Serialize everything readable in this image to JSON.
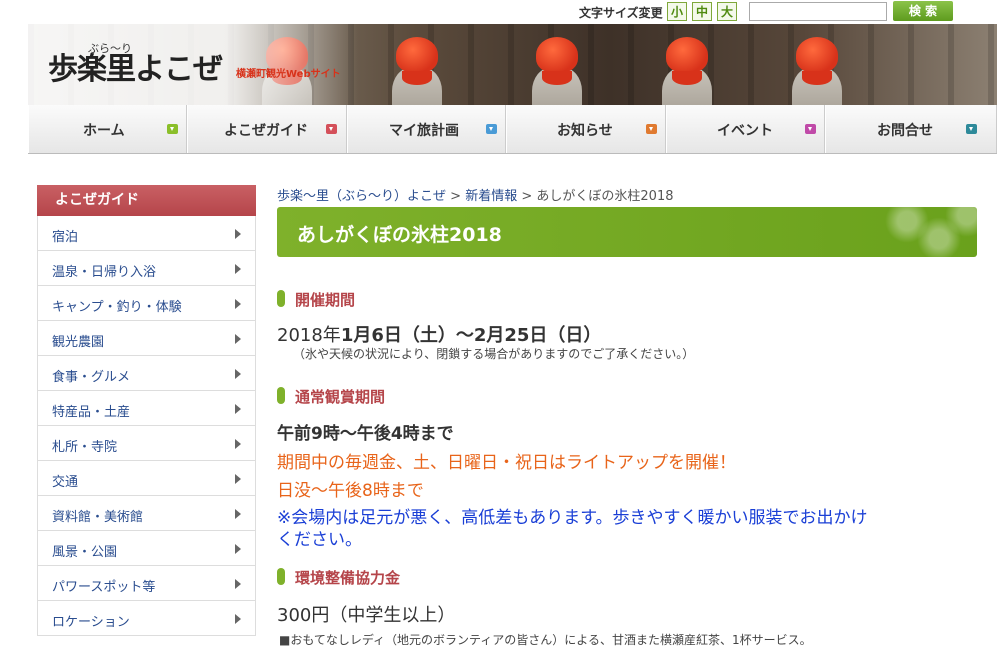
{
  "topbar": {
    "font_size_label": "文字サイズ変更",
    "font_sizes": [
      "小",
      "中",
      "大"
    ],
    "search_placeholder": "",
    "search_button": "検 索"
  },
  "header": {
    "logo_main": "歩楽里よこぜ",
    "logo_ruby": "ぶら〜り",
    "logo_sub": "横瀬町観光Webサイト"
  },
  "nav": {
    "items": [
      {
        "label": "ホーム",
        "color": "#8bbf2a"
      },
      {
        "label": "よこぜガイド",
        "color": "#d4505a"
      },
      {
        "label": "マイ旅計画",
        "color": "#4a9bd6"
      },
      {
        "label": "お知らせ",
        "color": "#e07a30"
      },
      {
        "label": "イベント",
        "color": "#c04aa8"
      },
      {
        "label": "お問合せ",
        "color": "#2e8a9a"
      }
    ]
  },
  "sidebar": {
    "heading": "よこぜガイド",
    "items": [
      "宿泊",
      "温泉・日帰り入浴",
      "キャンプ・釣り・体験",
      "観光農園",
      "食事・グルメ",
      "特産品・土産",
      "札所・寺院",
      "交通",
      "資料館・美術館",
      "風景・公園",
      "パワースポット等",
      "ロケーション"
    ]
  },
  "breadcrumb": {
    "home": "歩楽〜里（ぶら〜り）よこぜ",
    "sep": ">",
    "section": "新着情報",
    "current": "あしがくぼの氷柱2018"
  },
  "page": {
    "title": "あしがくぼの氷柱2018",
    "period_heading": "開催期間",
    "period_year": "2018年",
    "period_dates": "1月6日（土）〜2月25日（日）",
    "period_note": "（氷や天候の状況により、閉鎖する場合がありますのでご了承ください。）",
    "hours_heading": "通常観賞期間",
    "hours_main": "午前9時〜午後4時まで",
    "hours_lightup": "期間中の毎週金、土、日曜日・祝日はライトアップを開催！",
    "hours_lightup_time": "日没〜午後8時まで",
    "hours_warning_1": "※会場内は足元が悪く、高低差もあります。歩きやすく暖かい服装でお出かけ",
    "hours_warning_2": "ください。",
    "fee_heading": "環境整備協力金",
    "fee_amount": "300円（中学生以上）",
    "fee_note": "■おもてなしレディ（地元のボランティアの皆さん）による、甘酒また横瀬産紅茶、1杯サービス。"
  }
}
